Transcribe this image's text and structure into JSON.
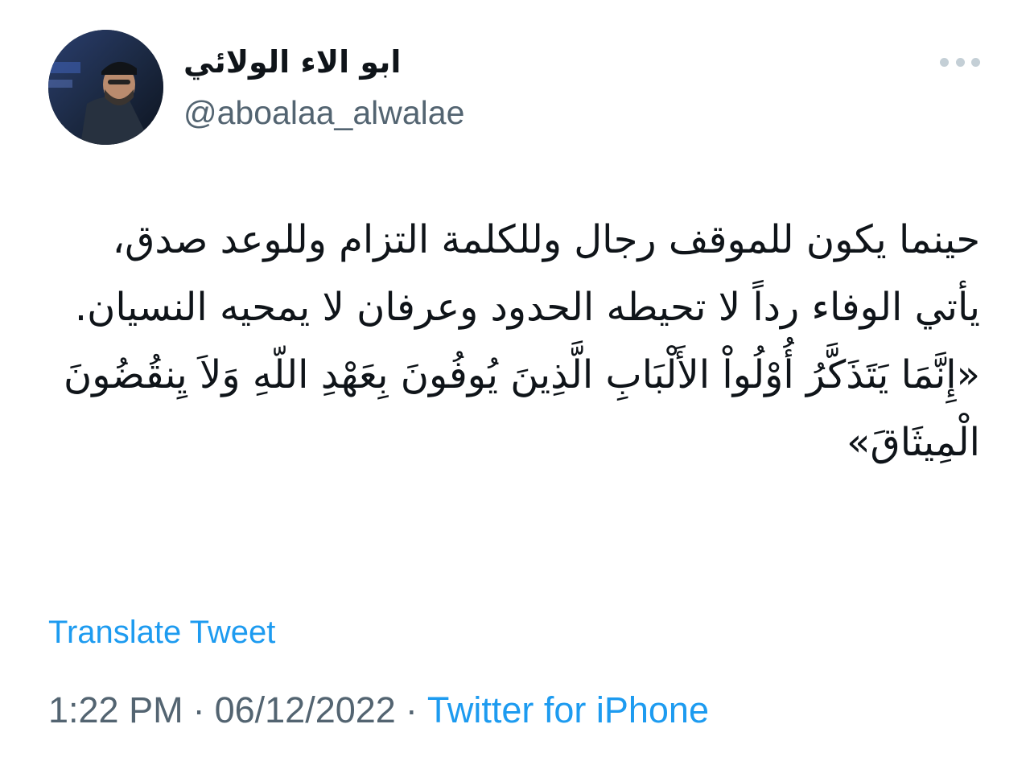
{
  "author": {
    "display_name": "ابو الاء الولائي",
    "handle": "@aboalaa_alwalae",
    "avatar_icon": "profile-photo"
  },
  "menu": {
    "icon": "more-options-icon"
  },
  "tweet": {
    "paragraphs": [
      "حينما يكون للموقف رجال وللكلمة التزام وللوعد صدق، يأتي الوفاء رداً لا تحيطه الحدود وعرفان لا يمحيه النسيان.",
      "«إِنَّمَا يَتَذَكَّرُ أُوْلُواْ الأَلْبَابِ الَّذِينَ يُوفُونَ بِعَهْدِ اللّهِ وَلاَ يِنقُضُونَ الْمِيثَاقَ»"
    ],
    "translate_label": "Translate Tweet",
    "time": "1:22 PM",
    "separator": "·",
    "date": "06/12/2022",
    "source": "Twitter for iPhone"
  },
  "colors": {
    "link": "#1d9bf0",
    "secondary_text": "#536471",
    "primary_text": "#0f1419",
    "menu_dots": "#c4cfd6"
  }
}
